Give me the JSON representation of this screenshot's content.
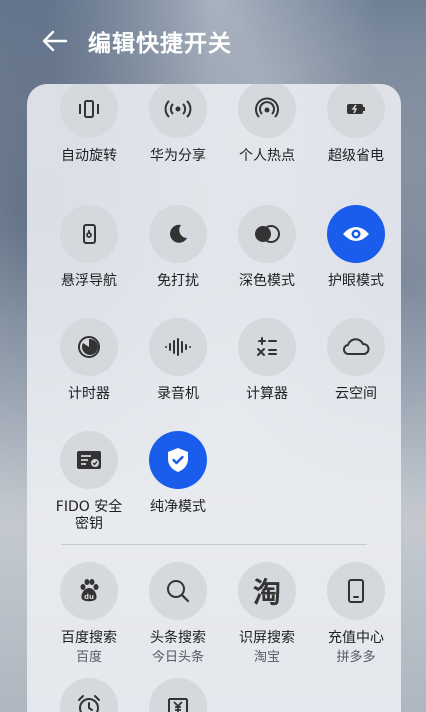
{
  "header": {
    "title": "编辑快捷开关"
  },
  "colors": {
    "accent": "#1a5ded",
    "tile_bg": "#d5d8dd"
  },
  "tiles": [
    {
      "label": "自动旋转",
      "icon": "auto-rotate-icon"
    },
    {
      "label": "华为分享",
      "icon": "huawei-share-icon"
    },
    {
      "label": "个人热点",
      "icon": "hotspot-icon"
    },
    {
      "label": "超级省电",
      "icon": "battery-saver-icon"
    },
    {
      "label": "悬浮导航",
      "icon": "floating-nav-icon"
    },
    {
      "label": "免打扰",
      "icon": "do-not-disturb-icon"
    },
    {
      "label": "深色模式",
      "icon": "dark-mode-icon"
    },
    {
      "label": "护眼模式",
      "icon": "eye-comfort-icon",
      "active": true
    },
    {
      "label": "计时器",
      "icon": "timer-icon"
    },
    {
      "label": "录音机",
      "icon": "voice-recorder-icon"
    },
    {
      "label": "计算器",
      "icon": "calculator-icon"
    },
    {
      "label": "云空间",
      "icon": "cloud-icon"
    },
    {
      "label": "FIDO 安全\n密钥",
      "line1": "FIDO 安全",
      "line2": "密钥",
      "icon": "security-key-icon"
    },
    {
      "label": "纯净模式",
      "icon": "pure-mode-shield-icon",
      "active": true
    }
  ],
  "third_party": [
    {
      "label": "百度搜索",
      "sub": "百度",
      "icon": "baidu-paw-icon"
    },
    {
      "label": "头条搜索",
      "sub": "今日头条",
      "icon": "search-icon"
    },
    {
      "label": "识屏搜索",
      "sub": "淘宝",
      "icon": "taobao-icon",
      "glyph": "淘"
    },
    {
      "label": "充值中心",
      "sub": "拼多多",
      "icon": "phone-topup-icon"
    },
    {
      "label": "",
      "icon": "alarm-clock-icon"
    },
    {
      "label": "",
      "icon": "yen-wallet-icon"
    }
  ]
}
